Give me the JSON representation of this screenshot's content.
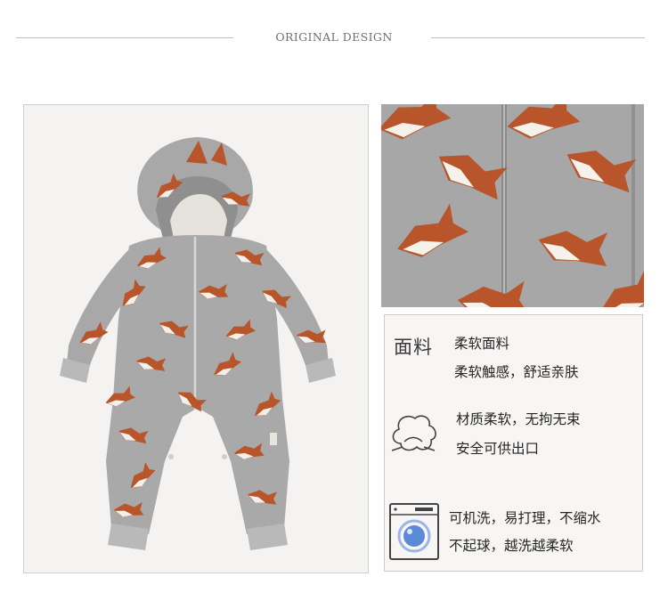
{
  "header": {
    "title": "ORIGINAL DESIGN"
  },
  "product": {
    "image_name": "shark-print hooded baby romper"
  },
  "colors": {
    "fabric_gray": "#a9a9a9",
    "shark_orange": "#b8552b",
    "accent_blue": "#5a8ad8",
    "text": "#262626"
  },
  "features": {
    "fabric": {
      "title": "面料",
      "line1": "柔软面料",
      "line2": "柔软触感，舒适亲肤",
      "icon": "fabric-text-icon"
    },
    "material": {
      "line1": "材质柔软，无拘无束",
      "line2": "安全可供出口",
      "icon": "cloud-soft-icon"
    },
    "wash": {
      "line1": "可机洗，易打理，不缩水",
      "line2": "不起球，越洗越柔软",
      "icon": "washing-machine-icon"
    }
  }
}
